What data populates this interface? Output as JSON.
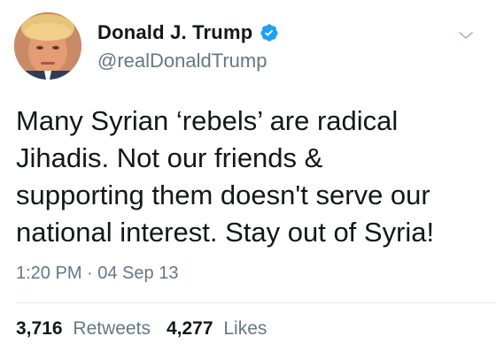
{
  "user": {
    "display_name": "Donald J. Trump",
    "handle": "@realDonaldTrump",
    "verified": true,
    "avatar_icon": "profile-photo-avatar",
    "verified_icon": "verified-badge-icon",
    "verified_color": "#1da1f2"
  },
  "tweet": {
    "text": "Many Syrian ‘rebels’ are radical\nJihadis. Not our friends &\nsupporting them doesn't serve our\nnational interest. Stay out of Syria!",
    "timestamp": "1:20 PM · 04 Sep 13"
  },
  "stats": {
    "retweets_count": "3,716",
    "retweets_label": "Retweets",
    "likes_count": "4,277",
    "likes_label": "Likes"
  },
  "menu": {
    "icon": "chevron-down-icon"
  }
}
